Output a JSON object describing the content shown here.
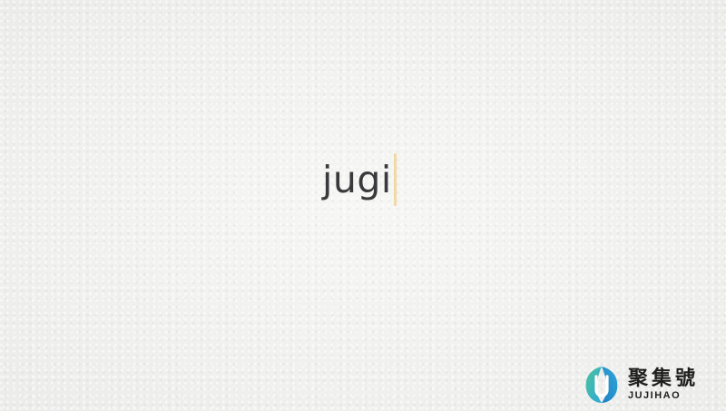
{
  "editor": {
    "typed_text": "jugi",
    "caret_color": "#f1d9a6",
    "text_color": "#3a3a3c"
  },
  "watermark": {
    "name_cn": "聚集號",
    "name_en": "JUJIHAO",
    "colors": [
      "#2fa8d8",
      "#4cc39a"
    ]
  }
}
